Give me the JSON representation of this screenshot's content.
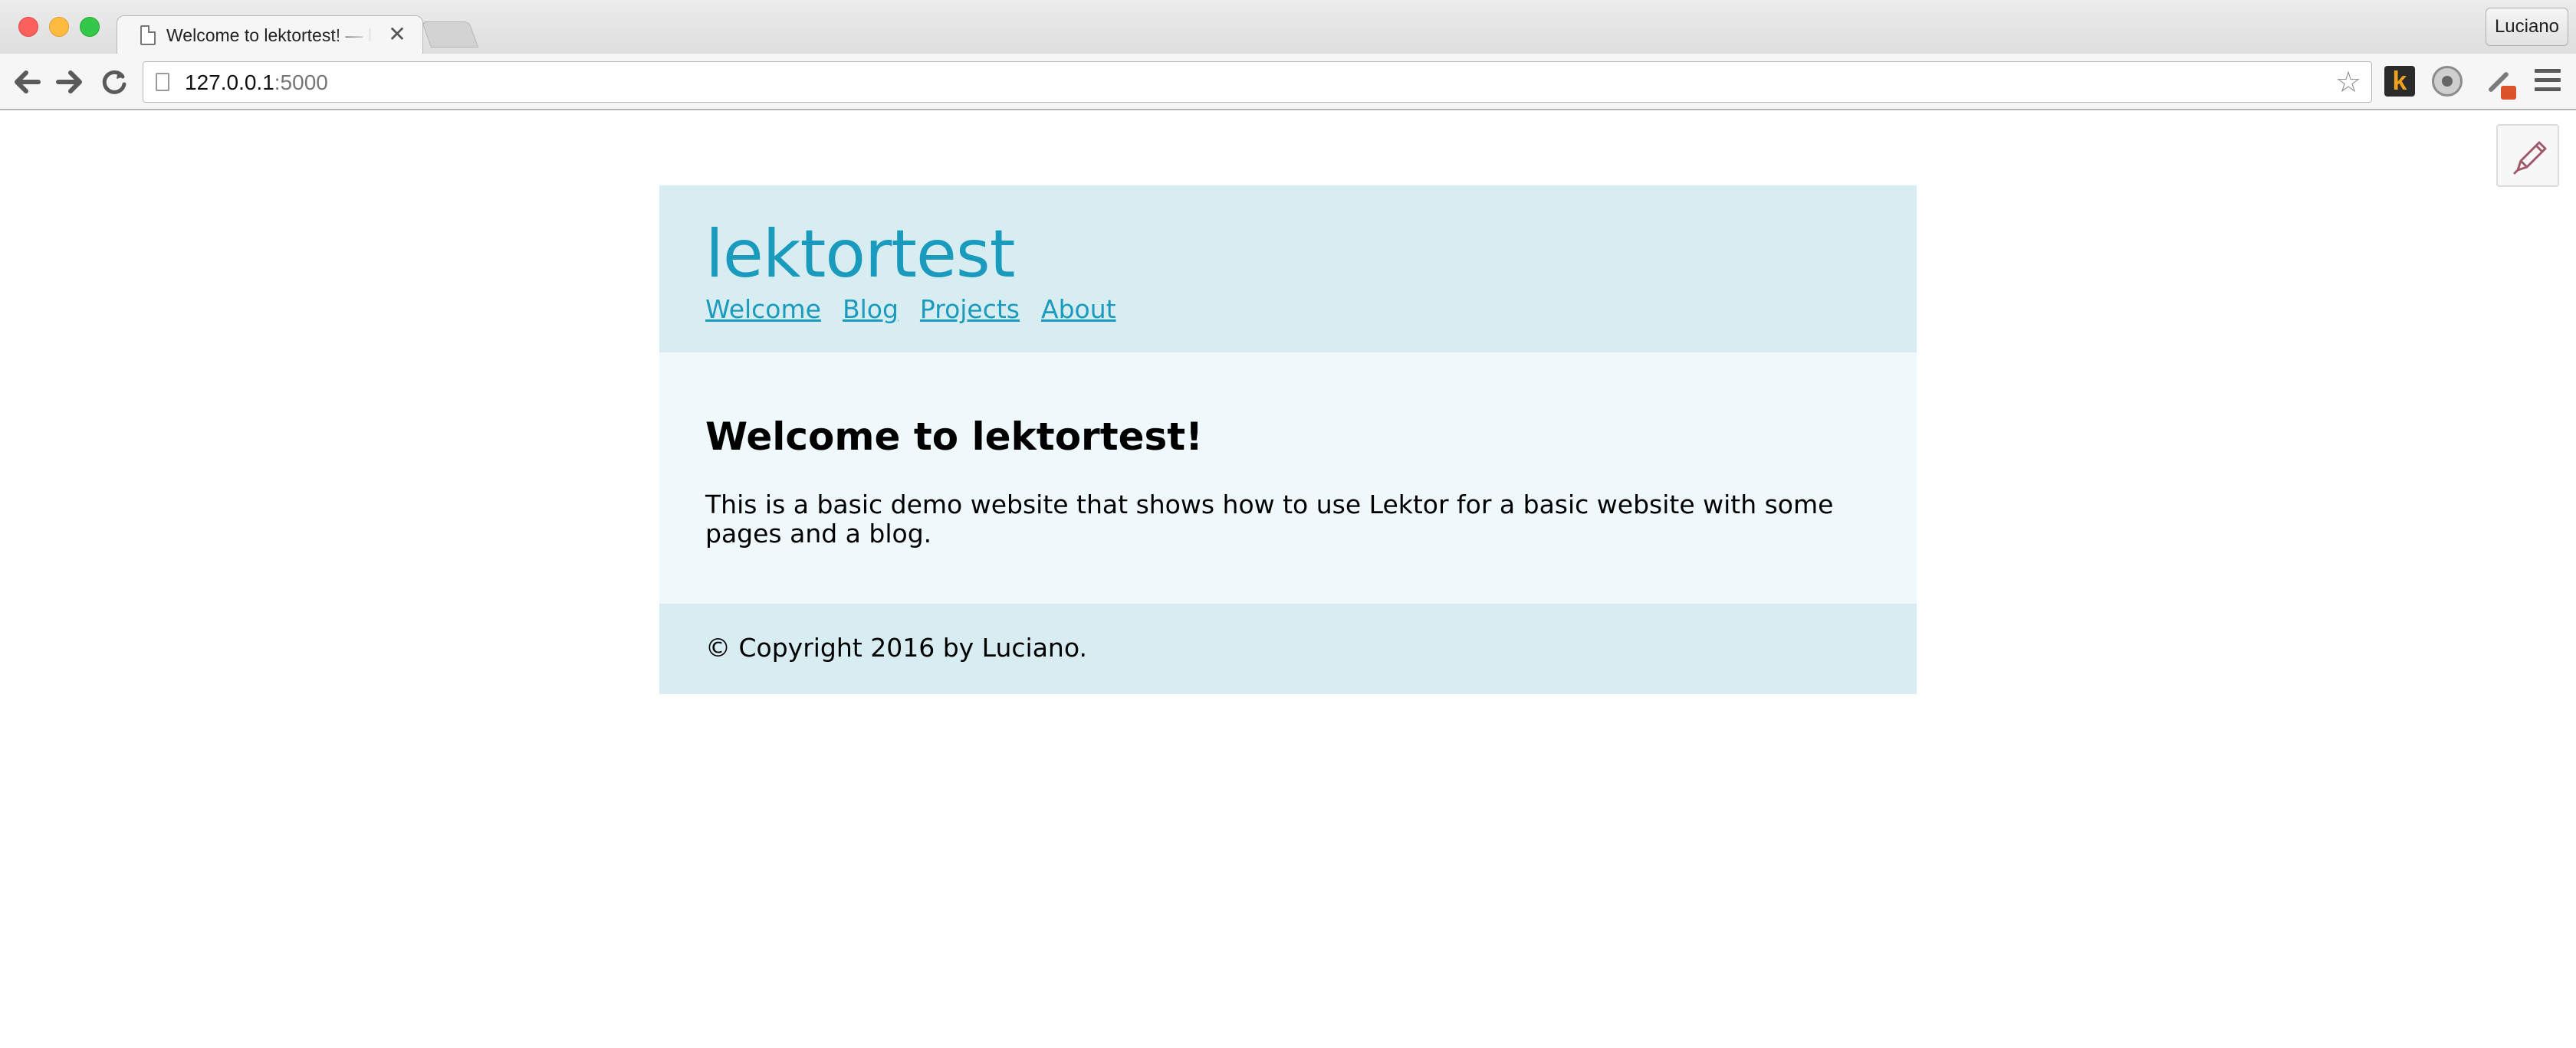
{
  "browser": {
    "tab": {
      "title": "Welcome to lektortest! — lektortest",
      "close_glyph": "✕",
      "icon": "page-icon"
    },
    "profile_name": "Luciano",
    "toolbar": {
      "back_glyph": "🡐",
      "forward_glyph": "🡒",
      "reload_glyph": "↻",
      "url_host": "127.0.0.1",
      "url_port": ":5000",
      "star_glyph": "☆"
    },
    "extensions": {
      "k_label": "k"
    }
  },
  "page": {
    "edit_icon": "pencil-icon",
    "site_title": "lektortest",
    "nav": [
      "Welcome",
      "Blog",
      "Projects",
      "About"
    ],
    "heading": "Welcome to lektortest!",
    "paragraph": "This is a basic demo website that shows how to use Lektor for a basic website with some pages and a blog.",
    "footer": "© Copyright 2016 by Luciano."
  },
  "colors": {
    "brand_link": "#1a9bbd",
    "header_bg": "#d8edf2",
    "body_bg": "#eff8fa"
  }
}
